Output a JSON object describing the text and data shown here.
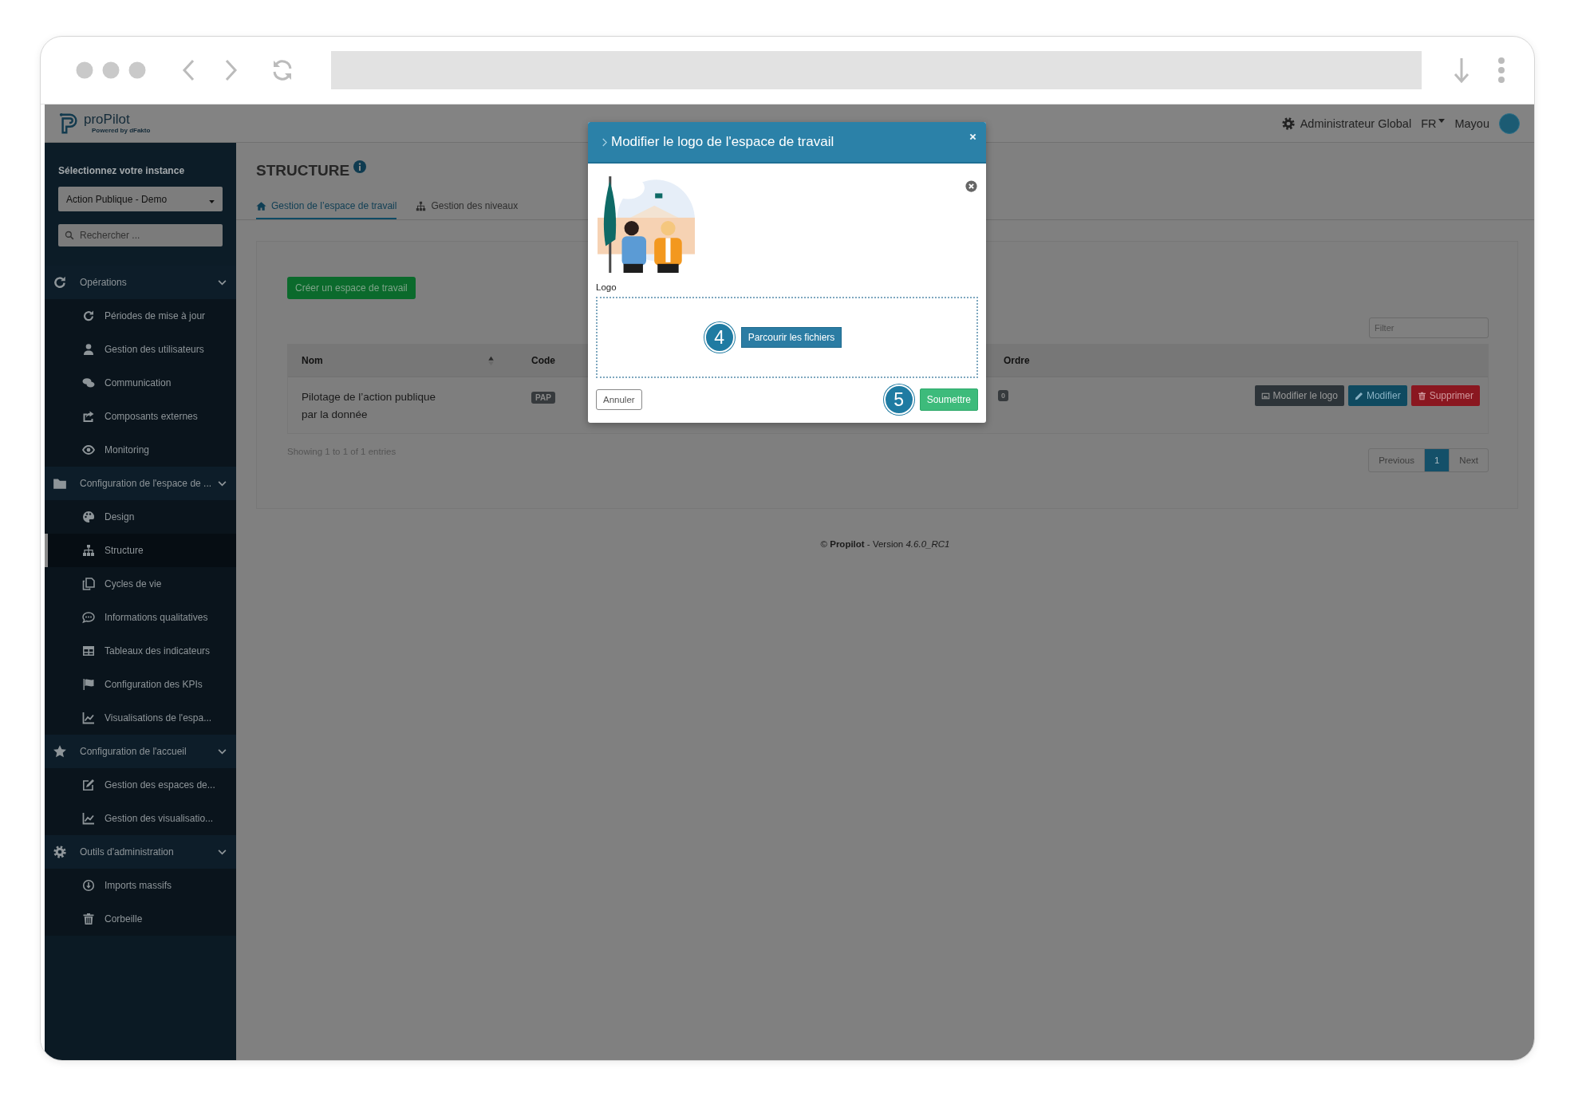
{
  "app": {
    "brand": "proPilot",
    "brand_tagline": "Powered by dFakto"
  },
  "header": {
    "role": "Administrateur Global",
    "language": "FR",
    "user": "Mayou"
  },
  "sidebar": {
    "instance_label": "Sélectionnez votre instance",
    "instance": "Action Publique - Demo",
    "search_placeholder": "Rechercher ...",
    "groups": [
      {
        "label": "Opérations",
        "expanded": true,
        "children": [
          {
            "label": "Périodes de mise à jour",
            "selected": false
          },
          {
            "label": "Gestion des utilisateurs",
            "selected": false
          },
          {
            "label": "Communication",
            "selected": false
          },
          {
            "label": "Composants externes",
            "selected": false
          },
          {
            "label": "Monitoring",
            "selected": false
          }
        ]
      },
      {
        "label": "Configuration de l'espace de ...",
        "expanded": true,
        "children": [
          {
            "label": "Design",
            "selected": false
          },
          {
            "label": "Structure",
            "selected": true
          },
          {
            "label": "Cycles de vie",
            "selected": false
          },
          {
            "label": "Informations qualitatives",
            "selected": false
          },
          {
            "label": "Tableaux des indicateurs",
            "selected": false
          },
          {
            "label": "Configuration des KPIs",
            "selected": false
          },
          {
            "label": "Visualisations de l'espa...",
            "selected": false
          }
        ]
      },
      {
        "label": "Configuration de l'accueil",
        "expanded": true,
        "children": [
          {
            "label": "Gestion des espaces de...",
            "selected": false
          },
          {
            "label": "Gestion des visualisatio...",
            "selected": false
          }
        ]
      },
      {
        "label": "Outils d'administration",
        "expanded": true,
        "children": [
          {
            "label": "Imports massifs",
            "selected": false
          },
          {
            "label": "Corbeille",
            "selected": false
          }
        ]
      }
    ]
  },
  "page": {
    "title": "STRUCTURE",
    "tabs": [
      {
        "label": "Gestion de l’espace de travail",
        "selected": true
      },
      {
        "label": "Gestion des niveaux",
        "selected": false
      }
    ],
    "create_button": "Créer un espace de travail",
    "filter_placeholder": "Filter",
    "table": {
      "columns": [
        "Nom",
        "Code",
        "Ordre"
      ],
      "rows": [
        {
          "nom": "Pilotage de l’action publique par la donnée",
          "code": "PAP",
          "ordre": "0",
          "actions": [
            {
              "kind": "logo",
              "label": "Modifier le logo"
            },
            {
              "kind": "edit",
              "label": "Modifier"
            },
            {
              "kind": "delete",
              "label": "Supprimer"
            }
          ]
        }
      ]
    },
    "info": "Showing 1 to 1 of 1 entries",
    "pagination": {
      "previous": "Previous",
      "pages": [
        {
          "label": "1",
          "selected": true
        }
      ],
      "next": "Next"
    }
  },
  "footer": "© **Propilot** - Version *4.6.0_RC1*",
  "modal": {
    "title": "Modifier le logo de l'espace de travail",
    "logo_label": "Logo",
    "browse_step": "4",
    "browse_button": "Parcourir les fichiers",
    "cancel_button": "Annuler",
    "submit_step": "5",
    "submit_button": "Soumettre"
  }
}
